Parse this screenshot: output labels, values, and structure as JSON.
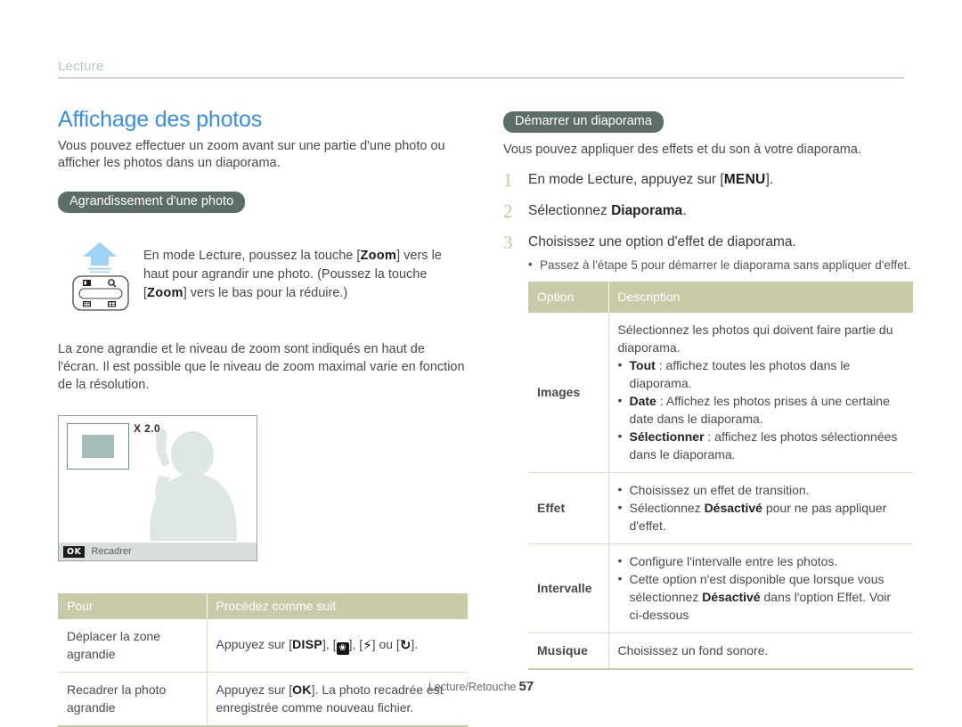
{
  "running_head": {
    "text": "Lecture"
  },
  "left": {
    "title": "Affichage des photos",
    "intro": "Vous pouvez effectuer un zoom avant sur une partie d'une photo ou afficher les photos dans un diaporama.",
    "section_pill": "Agrandissement d'une photo",
    "lever_text_1": "En mode Lecture, poussez la touche [",
    "lever_key": "Zoom",
    "lever_text_2": "] vers le haut pour agrandir une photo. (Poussez la touche [",
    "lever_key_2": "Zoom",
    "lever_text_3": "] vers le bas pour la réduire.)",
    "note": "La zone agrandie et le niveau de zoom sont indiqués en haut de l'écran. Il est possible que le niveau de zoom maximal varie en fonction de la résolution.",
    "screen": {
      "zoom_label": "X 2.0",
      "ok_key": "OK",
      "bar_label": "Recadrer"
    },
    "table": {
      "headers": [
        "Pour",
        "Procédez comme suit"
      ],
      "rows": [
        {
          "label": "Déplacer la zone agrandie",
          "desc_pre": "Appuyez sur [",
          "key1": "DISP",
          "desc_mid1": "], [",
          "key2": "macro-icon",
          "desc_mid2": "], [",
          "key3": "flash-icon",
          "desc_mid3": "] ou [",
          "key4": "timer-icon",
          "desc_post": "]."
        },
        {
          "label": "Recadrer la photo agrandie",
          "desc_pre": "Appuyez sur [",
          "key1": "OK",
          "desc_post": "]. La photo recadrée est enregistrée comme nouveau fichier."
        }
      ]
    }
  },
  "right": {
    "section_pill": "Démarrer un diaporama",
    "intro": "Vous pouvez appliquer des effets et du son à votre diaporama.",
    "steps": [
      {
        "num": "1",
        "pre": "En mode Lecture, appuyez sur [",
        "key": "MENU",
        "post": "]."
      },
      {
        "num": "2",
        "pre": "Sélectionnez ",
        "key": "Diaporama",
        "post": "."
      },
      {
        "num": "3",
        "pre": "Choisissez une option d'effet de diaporama.",
        "key": "",
        "post": ""
      }
    ],
    "step3_bullet": "Passez à l'étape 5 pour démarrer le diaporama sans appliquer d'effet.",
    "table": {
      "headers": [
        "Option",
        "Description"
      ],
      "rows": [
        {
          "option": "Images",
          "lead": "Sélectionnez les photos qui doivent faire partie du diaporama.",
          "bullets": [
            {
              "bold": "Tout",
              "text": " : affichez toutes les photos dans le diaporama."
            },
            {
              "bold": "Date",
              "text": " : Affichez les photos prises à une certaine date dans le diaporama."
            },
            {
              "bold": "Sélectionner",
              "text": " : affichez les photos sélectionnées dans le diaporama."
            }
          ]
        },
        {
          "option": "Effet",
          "lead": "",
          "bullets": [
            {
              "bold": "",
              "text": "Choisissez un effet de transition."
            },
            {
              "bold": "",
              "pre": "Sélectionnez ",
              "boldmid": "Désactivé",
              "text": " pour ne pas appliquer d'effet."
            }
          ]
        },
        {
          "option": "Intervalle",
          "lead": "",
          "bullets": [
            {
              "bold": "",
              "text": "Configure l'intervalle entre les photos."
            },
            {
              "bold": "",
              "pre": "Cette option n'est disponible que lorsque vous sélectionnez ",
              "boldmid": "Désactivé",
              "text": " dans l'option Effet. Voir ci-dessous"
            }
          ]
        },
        {
          "option": "Musique",
          "lead": "Choisissez un fond sonore.",
          "bullets": []
        }
      ]
    }
  },
  "footer": {
    "label": "Lecture/Retouche",
    "page": "57"
  },
  "colors": {
    "title_blue": "#3b8ede",
    "pill_green": "#5c6d6a",
    "table_header": "#c9caa8",
    "step_num": "#c2c6a4",
    "rule_mauve": "#b3a0a3"
  }
}
